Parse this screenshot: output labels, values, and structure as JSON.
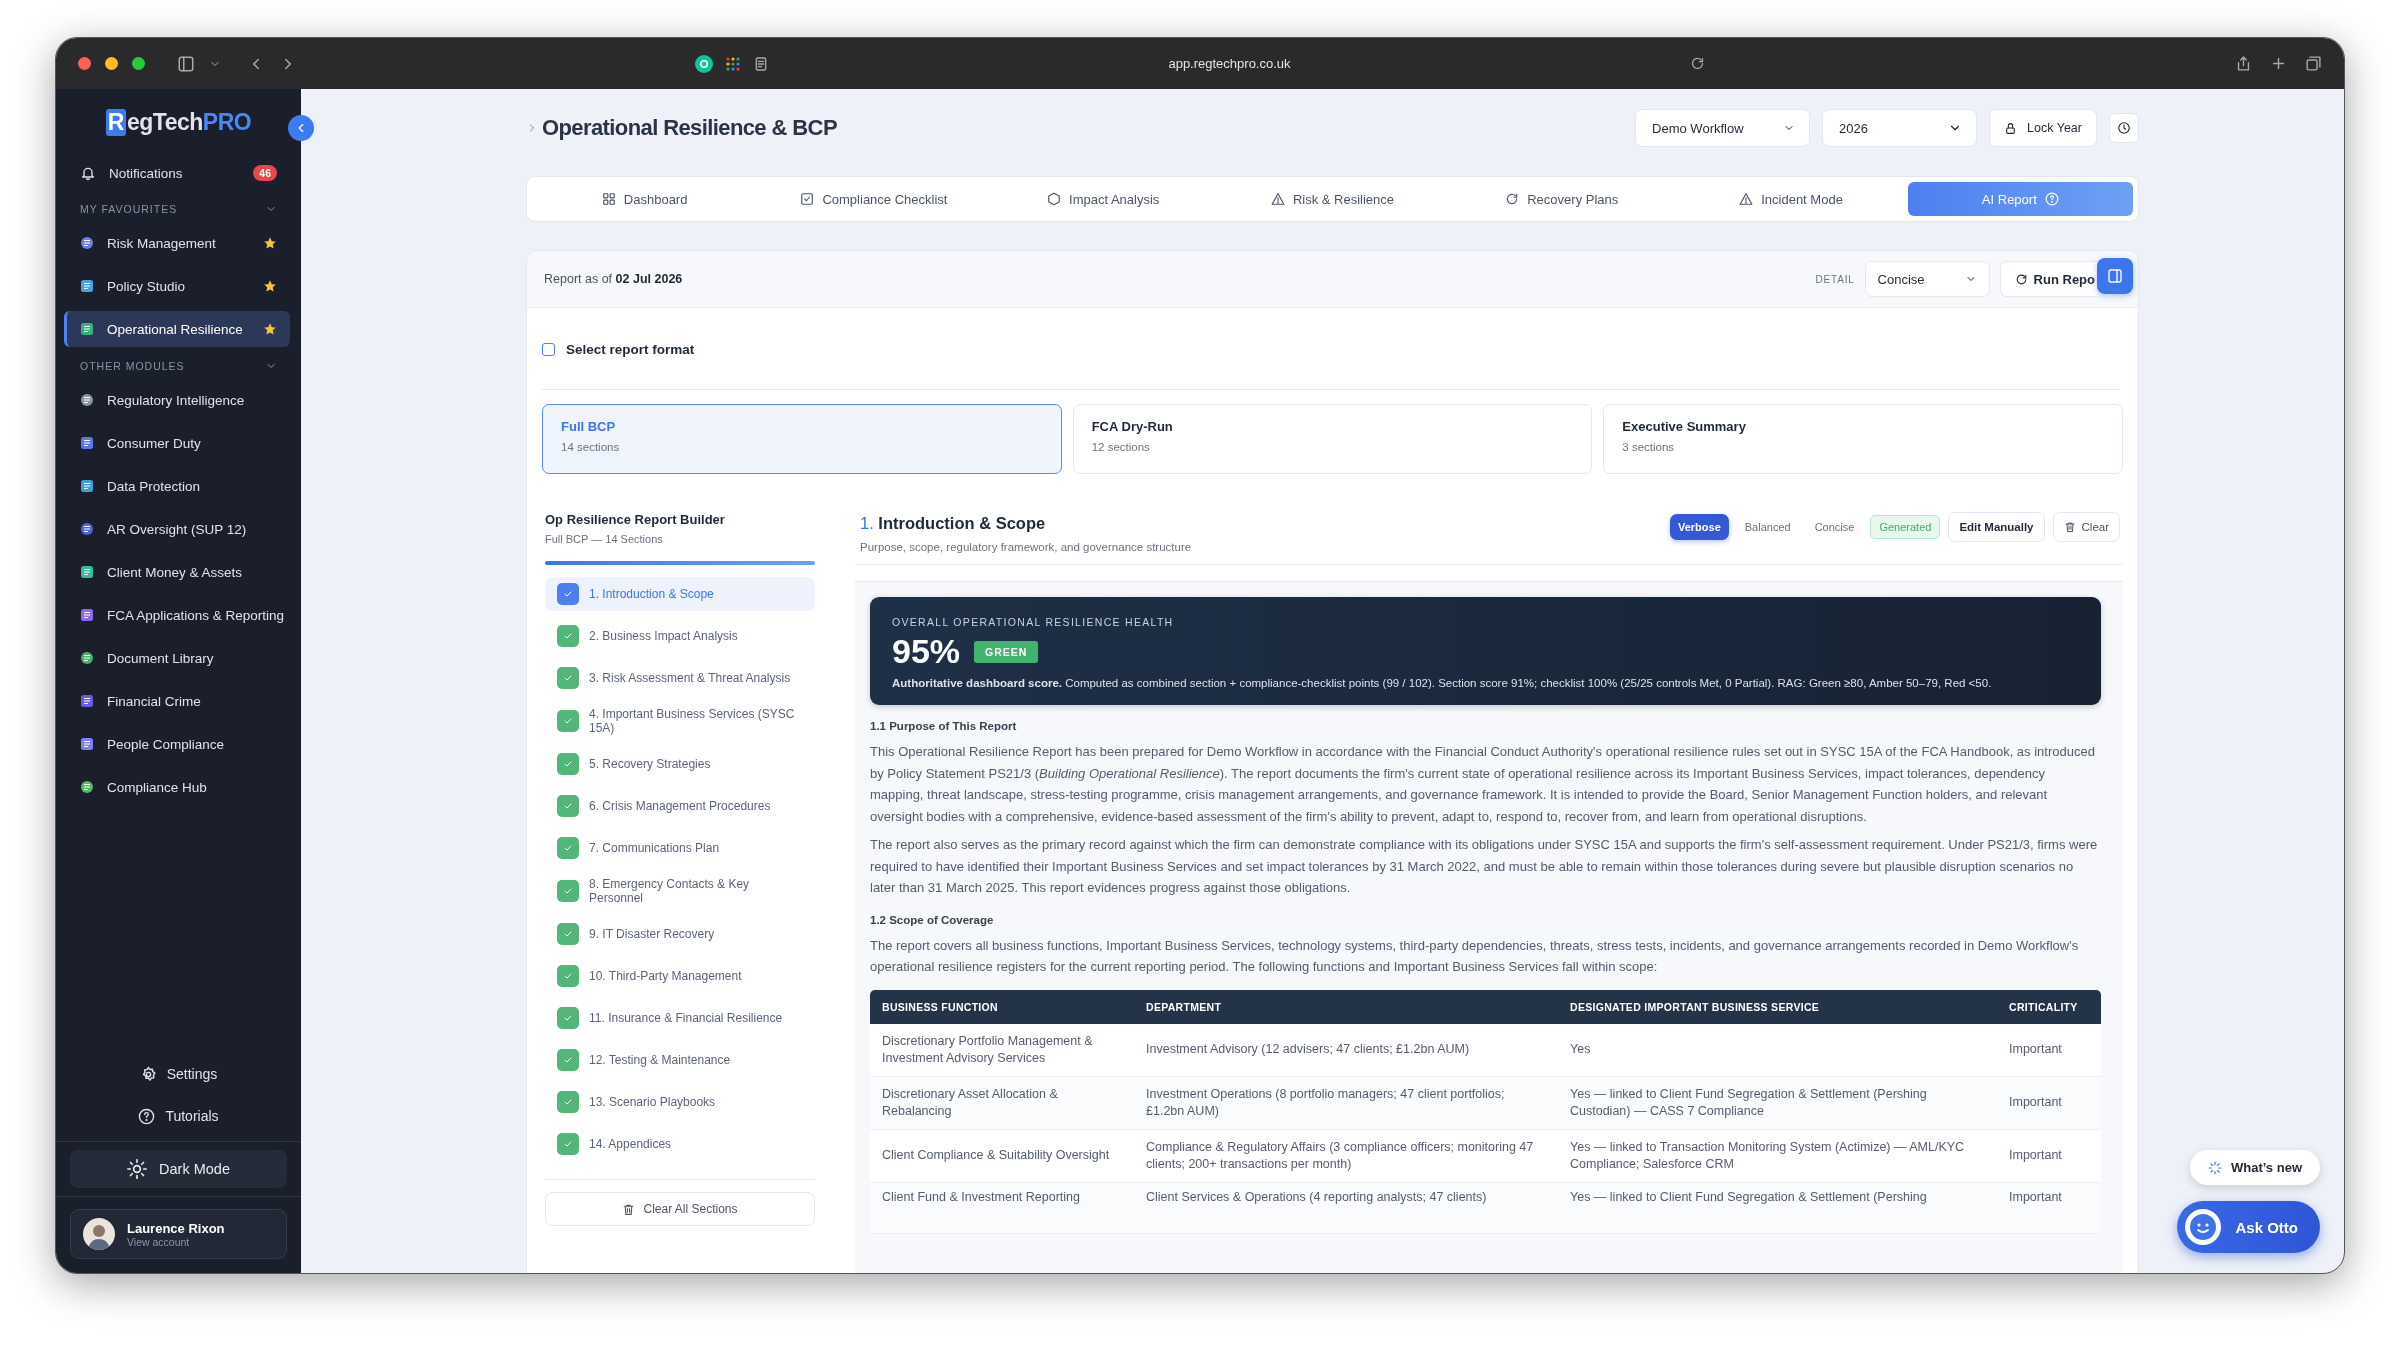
{
  "browser": {
    "url": "app.regtechpro.co.uk"
  },
  "sidebar": {
    "logo_letter": "R",
    "logo_text": "egTech",
    "logo_accent": "PRO",
    "notifications": {
      "label": "Notifications",
      "count": "46"
    },
    "groups": [
      {
        "title": "MY FAVOURITES",
        "expanded": true,
        "items": [
          {
            "label": "Risk Management",
            "favourite": true,
            "selected": false
          },
          {
            "label": "Policy Studio",
            "favourite": true,
            "selected": false
          },
          {
            "label": "Operational Resilience",
            "favourite": true,
            "selected": true
          }
        ]
      },
      {
        "title": "OTHER MODULES",
        "expanded": true,
        "items": [
          {
            "label": "Regulatory Intelligence",
            "favourite": false,
            "selected": false
          },
          {
            "label": "Consumer Duty",
            "favourite": false,
            "selected": false
          },
          {
            "label": "Data Protection",
            "favourite": false,
            "selected": false
          },
          {
            "label": "AR Oversight (SUP 12)",
            "favourite": false,
            "selected": false
          },
          {
            "label": "Client Money & Assets",
            "favourite": false,
            "selected": false
          },
          {
            "label": "FCA Applications & Reporting",
            "favourite": false,
            "selected": false
          },
          {
            "label": "Document Library",
            "favourite": false,
            "selected": false
          },
          {
            "label": "Financial Crime",
            "favourite": false,
            "selected": false
          },
          {
            "label": "People Compliance",
            "favourite": false,
            "selected": false
          },
          {
            "label": "Compliance Hub",
            "favourite": false,
            "selected": false
          }
        ]
      }
    ],
    "links": [
      "Settings",
      "Tutorials"
    ],
    "dark_mode": "Dark Mode",
    "account": {
      "name": "Laurence Rixon",
      "subtitle": "View account"
    }
  },
  "header": {
    "title": "Operational Resilience & BCP",
    "workflow": "Demo Workflow",
    "year": "2026",
    "lock": "Lock Year"
  },
  "tabs": [
    {
      "label": "Dashboard",
      "selected": false
    },
    {
      "label": "Compliance Checklist",
      "selected": false
    },
    {
      "label": "Impact Analysis",
      "selected": false
    },
    {
      "label": "Risk & Resilience",
      "selected": false
    },
    {
      "label": "Recovery Plans",
      "selected": false
    },
    {
      "label": "Incident Mode",
      "selected": false
    },
    {
      "label": "AI Report",
      "selected": true
    }
  ],
  "report": {
    "as_of_label": "Report as of",
    "as_of_date": "02 Jul 2026",
    "detail_label": "DETAIL",
    "detail_value": "Concise",
    "run_label": "Run Repo",
    "format_checkbox": {
      "label": "Select report format",
      "checked": false
    },
    "formats": [
      {
        "name": "Full BCP",
        "sections": "14 sections",
        "selected": true
      },
      {
        "name": "FCA Dry-Run",
        "sections": "12 sections",
        "selected": false
      },
      {
        "name": "Executive Summary",
        "sections": "3 sections",
        "selected": false
      }
    ]
  },
  "builder": {
    "title": "Op Resilience Report Builder",
    "subtitle": "Full BCP — 14 Sections",
    "level": 1,
    "sections": [
      {
        "label": "1. Introduction & Scope",
        "checked": true,
        "selected": true
      },
      {
        "label": "2. Business Impact Analysis",
        "checked": true,
        "selected": false
      },
      {
        "label": "3. Risk Assessment & Threat Analysis",
        "checked": true,
        "selected": false
      },
      {
        "label": "4. Important Business Services (SYSC 15A)",
        "checked": true,
        "selected": false
      },
      {
        "label": "5. Recovery Strategies",
        "checked": true,
        "selected": false
      },
      {
        "label": "6. Crisis Management Procedures",
        "checked": true,
        "selected": false
      },
      {
        "label": "7. Communications Plan",
        "checked": true,
        "selected": false
      },
      {
        "label": "8. Emergency Contacts & Key Personnel",
        "checked": true,
        "selected": false
      },
      {
        "label": "9. IT Disaster Recovery",
        "checked": true,
        "selected": false
      },
      {
        "label": "10. Third-Party Management",
        "checked": true,
        "selected": false
      },
      {
        "label": "11. Insurance & Financial Resilience",
        "checked": true,
        "selected": false
      },
      {
        "label": "12. Testing & Maintenance",
        "checked": true,
        "selected": false
      },
      {
        "label": "13. Scenario Playbooks",
        "checked": true,
        "selected": false
      },
      {
        "label": "14. Appendices",
        "checked": true,
        "selected": false
      }
    ],
    "clear_label": "Clear All Sections"
  },
  "section": {
    "number": "1.",
    "title": "Introduction & Scope",
    "subtitle": "Purpose, scope, regulatory framework, and governance structure",
    "modes": [
      {
        "label": "Verbose",
        "selected": true
      },
      {
        "label": "Balanced",
        "selected": false
      },
      {
        "label": "Concise",
        "selected": false
      }
    ],
    "status": "Generated",
    "edit_label": "Edit Manually",
    "clear_label": "Clear",
    "health": {
      "label": "OVERALL OPERATIONAL RESILIENCE HEALTH",
      "score": "95%",
      "rag": "GREEN",
      "note": "**Authoritative dashboard score.** Computed as combined section + compliance-checklist points (99 / 102). Section score 91%; checklist 100% (25/25 controls Met, 0 Partial). RAG: Green ≥80, Amber 50–79, Red <50."
    },
    "blocks": [
      {
        "kind": "heading",
        "text": "1.1 Purpose of This Report"
      },
      {
        "kind": "paragraph",
        "text": "This Operational Resilience Report has been prepared for Demo Workflow in accordance with the Financial Conduct Authority's operational resilience rules set out in SYSC 15A of the FCA Handbook, as introduced by Policy Statement PS21/3 (*Building Operational Resilience*). The report documents the firm's current state of operational resilience across its Important Business Services, impact tolerances, dependency mapping, threat landscape, stress-testing programme, crisis management arrangements, and governance framework. It is intended to provide the Board, Senior Management Function holders, and relevant oversight bodies with a comprehensive, evidence-based assessment of the firm's ability to prevent, adapt to, respond to, recover from, and learn from operational disruptions."
      },
      {
        "kind": "paragraph",
        "text": "The report also serves as the primary record against which the firm can demonstrate compliance with its obligations under SYSC 15A and supports the firm's self-assessment requirement. Under PS21/3, firms were required to have identified their Important Business Services and set impact tolerances by 31 March 2022, and must be able to remain within those tolerances during severe but plausible disruption scenarios no later than 31 March 2025. This report evidences progress against those obligations."
      },
      {
        "kind": "heading",
        "text": "1.2 Scope of Coverage"
      },
      {
        "kind": "paragraph",
        "text": "The report covers all business functions, Important Business Services, technology systems, third-party dependencies, threats, stress tests, incidents, and governance arrangements recorded in Demo Workflow's operational resilience registers for the current reporting period. The following functions and Important Business Services fall within scope:"
      },
      {
        "kind": "table",
        "columns": [
          "BUSINESS FUNCTION",
          "DEPARTMENT",
          "DESIGNATED IMPORTANT BUSINESS SERVICE",
          "CRITICALITY"
        ],
        "rows": [
          [
            "Discretionary Portfolio Management & Investment Advisory Services",
            "Investment Advisory (12 advisers; 47 clients; £1.2bn AUM)",
            "Yes",
            "Important"
          ],
          [
            "Discretionary Asset Allocation & Rebalancing",
            "Investment Operations (8 portfolio managers; 47 client portfolios; £1.2bn AUM)",
            "Yes — linked to Client Fund Segregation & Settlement (Pershing Custodian) — CASS 7 Compliance",
            "Important"
          ],
          [
            "Client Compliance & Suitability Oversight",
            "Compliance & Regulatory Affairs (3 compliance officers; monitoring 47 clients; 200+ transactions per month)",
            "Yes — linked to Transaction Monitoring System (Actimize) — AML/KYC Compliance; Salesforce CRM",
            "Important"
          ],
          [
            "Client Fund & Investment Reporting",
            "Client Services & Operations (4 reporting analysts; 47 clients)",
            "Yes — linked to Client Fund Segregation & Settlement (Pershing",
            "Important"
          ]
        ]
      }
    ]
  },
  "floating": {
    "whats_new": "What’s new",
    "ask": "Ask Otto"
  }
}
